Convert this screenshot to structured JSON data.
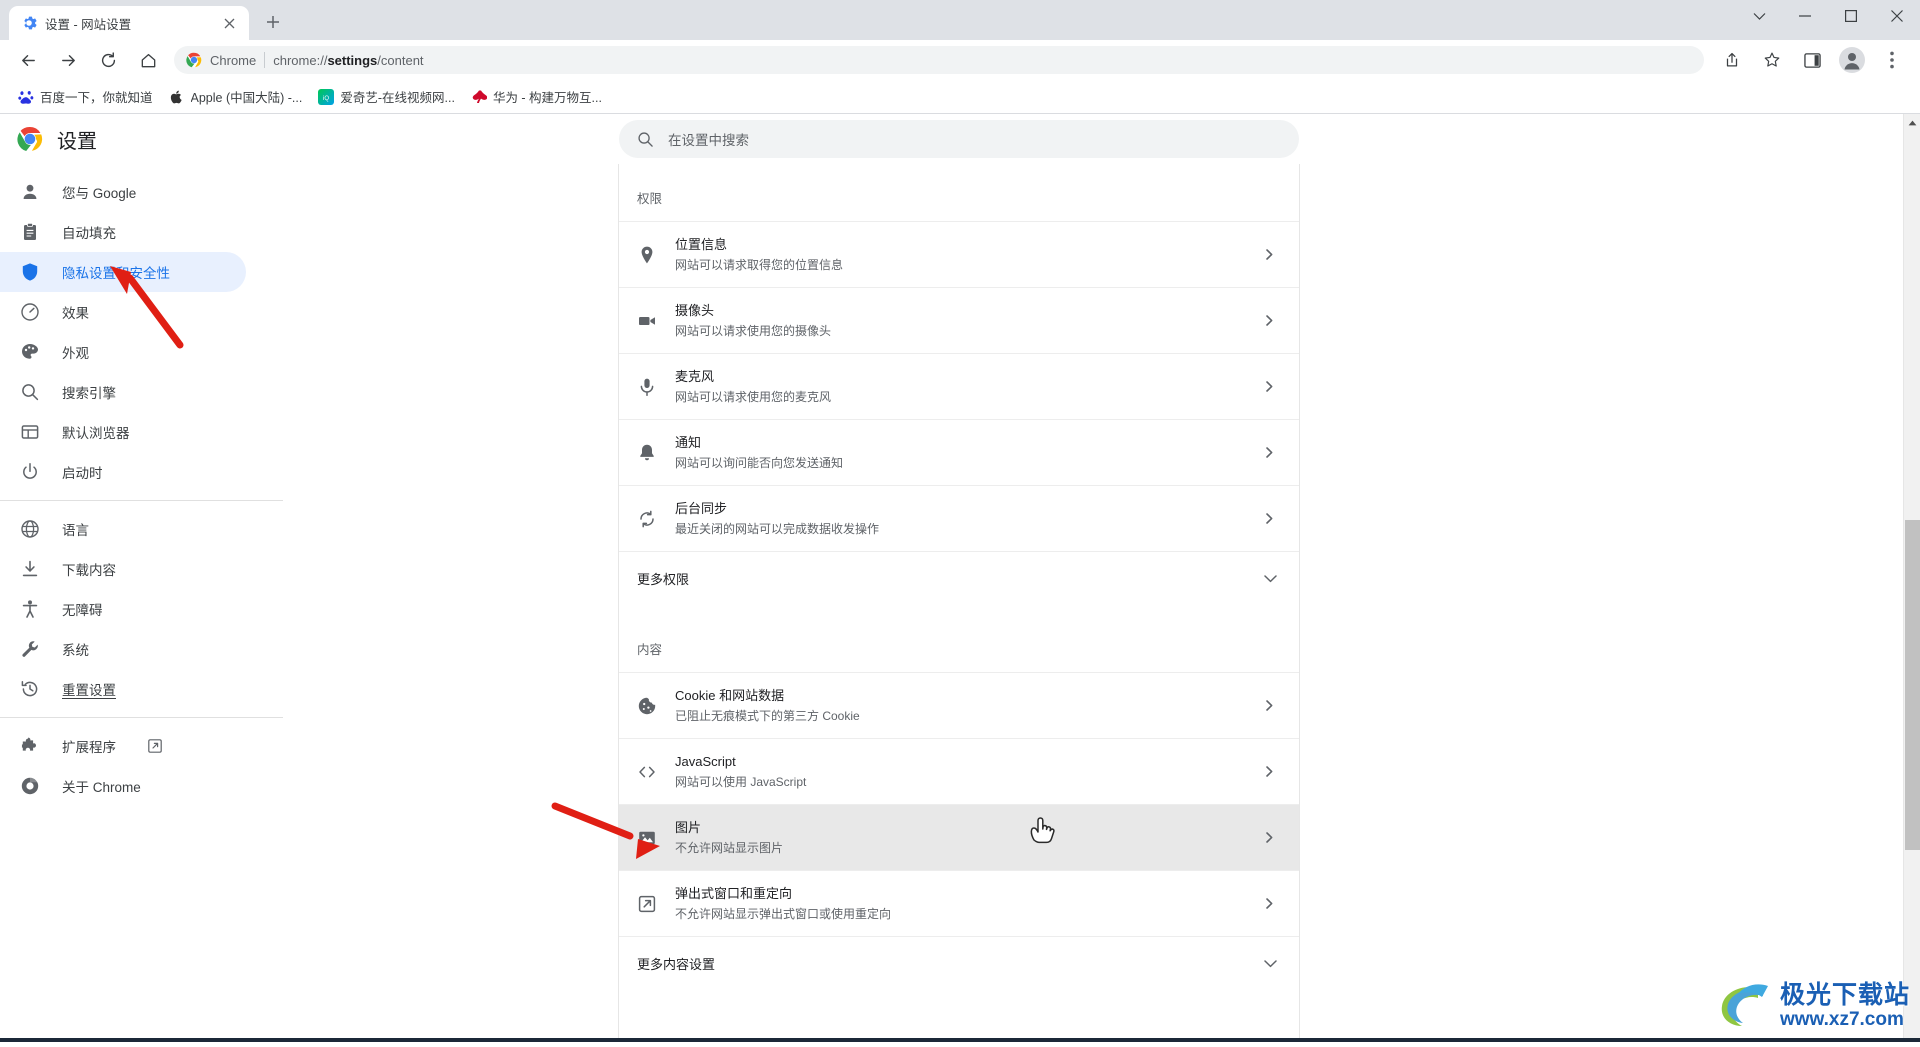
{
  "window": {
    "controls": [
      {
        "name": "chevron-down",
        "glyph": "⌄"
      },
      {
        "name": "minimize",
        "glyph": "—"
      },
      {
        "name": "maximize",
        "glyph": "▢"
      },
      {
        "name": "close",
        "glyph": "✕"
      }
    ]
  },
  "tab": {
    "title": "设置 - 网站设置",
    "close_label": "✕",
    "new_tab_label": "+"
  },
  "omnibox": {
    "chrome_label": "Chrome",
    "url_prefix": "chrome://",
    "url_bold": "settings",
    "url_suffix": "/content",
    "url_full": "chrome://settings/content"
  },
  "toolbar": {
    "back_label": "←",
    "forward_label": "→",
    "reload_label": "⟳",
    "home_label": "⌂",
    "share_label": "share-icon",
    "bookmark_label": "star-icon",
    "sidepanel_label": "side-panel-icon",
    "profile_label": "profile-avatar",
    "menu_label": "⋮"
  },
  "bookmarks": [
    {
      "label": "百度一下，你就知道",
      "icon": "baidu"
    },
    {
      "label": "Apple (中国大陆) -...",
      "icon": "apple"
    },
    {
      "label": "爱奇艺-在线视频网...",
      "icon": "iqiyi"
    },
    {
      "label": "华为 - 构建万物互...",
      "icon": "huawei"
    }
  ],
  "settings": {
    "brand_title": "设置",
    "search_placeholder": "在设置中搜索",
    "sidebar_groups": [
      {
        "items": [
          {
            "label": "您与 Google",
            "icon": "person-icon",
            "selected": false
          },
          {
            "label": "自动填充",
            "icon": "clipboard-icon",
            "selected": false
          },
          {
            "label": "隐私设置和安全性",
            "icon": "shield-icon",
            "selected": true
          },
          {
            "label": "效果",
            "icon": "speedometer-icon",
            "selected": false
          },
          {
            "label": "外观",
            "icon": "palette-icon",
            "selected": false
          },
          {
            "label": "搜索引擎",
            "icon": "search-icon",
            "selected": false
          },
          {
            "label": "默认浏览器",
            "icon": "browser-icon",
            "selected": false
          },
          {
            "label": "启动时",
            "icon": "power-icon",
            "selected": false
          }
        ]
      },
      {
        "items": [
          {
            "label": "语言",
            "icon": "globe-icon",
            "selected": false
          },
          {
            "label": "下载内容",
            "icon": "download-icon",
            "selected": false
          },
          {
            "label": "无障碍",
            "icon": "accessibility-icon",
            "selected": false
          },
          {
            "label": "系统",
            "icon": "wrench-icon",
            "selected": false
          },
          {
            "label": "重置设置",
            "icon": "history-icon",
            "selected": false
          }
        ]
      },
      {
        "items": [
          {
            "label": "扩展程序",
            "icon": "puzzle-icon",
            "selected": false,
            "external": true
          },
          {
            "label": "关于 Chrome",
            "icon": "chrome-icon",
            "selected": false
          }
        ]
      }
    ],
    "permissions": {
      "section_label": "权限",
      "rows": [
        {
          "title": "位置信息",
          "sub": "网站可以请求取得您的位置信息",
          "icon": "location-pin-icon"
        },
        {
          "title": "摄像头",
          "sub": "网站可以请求使用您的摄像头",
          "icon": "camera-icon"
        },
        {
          "title": "麦克风",
          "sub": "网站可以请求使用您的麦克风",
          "icon": "microphone-icon"
        },
        {
          "title": "通知",
          "sub": "网站可以询问能否向您发送通知",
          "icon": "bell-icon"
        },
        {
          "title": "后台同步",
          "sub": "最近关闭的网站可以完成数据收发操作",
          "icon": "sync-icon"
        }
      ],
      "expand_label": "更多权限"
    },
    "content": {
      "section_label": "内容",
      "rows": [
        {
          "title": "Cookie 和网站数据",
          "sub": "已阻止无痕模式下的第三方 Cookie",
          "icon": "cookie-icon",
          "highlight": false
        },
        {
          "title": "JavaScript",
          "sub": "网站可以使用 JavaScript",
          "icon": "code-icon",
          "highlight": false
        },
        {
          "title": "图片",
          "sub": "不允许网站显示图片",
          "icon": "image-icon",
          "highlight": true
        },
        {
          "title": "弹出式窗口和重定向",
          "sub": "不允许网站显示弹出式窗口或使用重定向",
          "icon": "popup-icon",
          "highlight": false
        }
      ],
      "expand_label": "更多内容设置"
    }
  },
  "watermark": {
    "cn": "极光下载站",
    "url": "www.xz7.com"
  },
  "colors": {
    "accent": "#1a73e8",
    "accent_bg": "#e8f0fe",
    "tab_bar": "#dee1e6",
    "omnibox_bg": "#f1f3f4",
    "highlight_row": "#e8e8e8",
    "annotation_red": "#e01f14",
    "watermark_blue": "#1a5fb4"
  }
}
